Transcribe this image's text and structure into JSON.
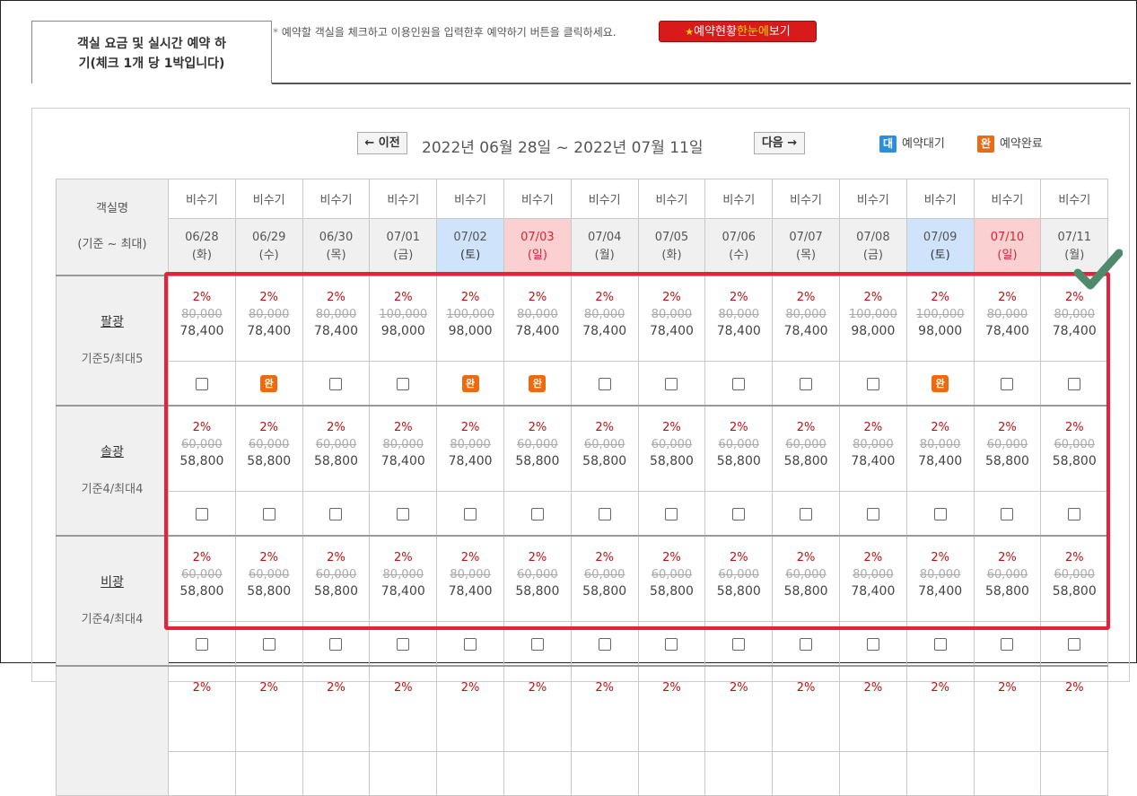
{
  "tab": {
    "title_line1": "객실 요금 및 실시간 예약 하",
    "title_line2": "기(체크 1개 당 1박입니다)"
  },
  "notice": {
    "icon": "*",
    "text": "예약할 객실을 체크하고 이용인원을 입력한후 예약하기 버튼을 클릭하세요."
  },
  "view_button": {
    "star": "★",
    "part1": "예약현황",
    "part2": "한눈에",
    "part3": "보기"
  },
  "nav": {
    "prev": "← 이전",
    "next": "다음 →",
    "range": "2022년 06월 28일 ~ 2022년 07월 11일"
  },
  "legend": {
    "waiting_badge": "대",
    "waiting_label": "예약대기",
    "waiting_color": "#2b8fd9",
    "done_badge": "완",
    "done_label": "예약완료",
    "done_color": "#ef6a0e"
  },
  "table": {
    "room_header_line1": "객실명",
    "room_header_line2": "(기준 ~ 최대)",
    "columns": [
      {
        "season": "비수기",
        "date": "06/28",
        "dow": "(화)",
        "type": "weekday"
      },
      {
        "season": "비수기",
        "date": "06/29",
        "dow": "(수)",
        "type": "weekday"
      },
      {
        "season": "비수기",
        "date": "06/30",
        "dow": "(목)",
        "type": "weekday"
      },
      {
        "season": "비수기",
        "date": "07/01",
        "dow": "(금)",
        "type": "weekday"
      },
      {
        "season": "비수기",
        "date": "07/02",
        "dow": "(토)",
        "type": "sat"
      },
      {
        "season": "비수기",
        "date": "07/03",
        "dow": "(일)",
        "type": "sun"
      },
      {
        "season": "비수기",
        "date": "07/04",
        "dow": "(월)",
        "type": "weekday"
      },
      {
        "season": "비수기",
        "date": "07/05",
        "dow": "(화)",
        "type": "weekday"
      },
      {
        "season": "비수기",
        "date": "07/06",
        "dow": "(수)",
        "type": "weekday"
      },
      {
        "season": "비수기",
        "date": "07/07",
        "dow": "(목)",
        "type": "weekday"
      },
      {
        "season": "비수기",
        "date": "07/08",
        "dow": "(금)",
        "type": "weekday"
      },
      {
        "season": "비수기",
        "date": "07/09",
        "dow": "(토)",
        "type": "sat"
      },
      {
        "season": "비수기",
        "date": "07/10",
        "dow": "(일)",
        "type": "sun"
      },
      {
        "season": "비수기",
        "date": "07/11",
        "dow": "(월)",
        "type": "weekday"
      }
    ],
    "rooms": [
      {
        "name": "팔광",
        "capacity": "기준5/최대5",
        "cells": [
          {
            "rate": "2%",
            "orig": "80,000",
            "price": "78,400",
            "status": "open"
          },
          {
            "rate": "2%",
            "orig": "80,000",
            "price": "78,400",
            "status": "done"
          },
          {
            "rate": "2%",
            "orig": "80,000",
            "price": "78,400",
            "status": "open"
          },
          {
            "rate": "2%",
            "orig": "100,000",
            "price": "98,000",
            "status": "open"
          },
          {
            "rate": "2%",
            "orig": "100,000",
            "price": "98,000",
            "status": "done"
          },
          {
            "rate": "2%",
            "orig": "80,000",
            "price": "78,400",
            "status": "done"
          },
          {
            "rate": "2%",
            "orig": "80,000",
            "price": "78,400",
            "status": "open"
          },
          {
            "rate": "2%",
            "orig": "80,000",
            "price": "78,400",
            "status": "open"
          },
          {
            "rate": "2%",
            "orig": "80,000",
            "price": "78,400",
            "status": "open"
          },
          {
            "rate": "2%",
            "orig": "80,000",
            "price": "78,400",
            "status": "open"
          },
          {
            "rate": "2%",
            "orig": "100,000",
            "price": "98,000",
            "status": "open"
          },
          {
            "rate": "2%",
            "orig": "100,000",
            "price": "98,000",
            "status": "done"
          },
          {
            "rate": "2%",
            "orig": "80,000",
            "price": "78,400",
            "status": "open"
          },
          {
            "rate": "2%",
            "orig": "80,000",
            "price": "78,400",
            "status": "open"
          }
        ]
      },
      {
        "name": "솔광",
        "capacity": "기준4/최대4",
        "cells": [
          {
            "rate": "2%",
            "orig": "60,000",
            "price": "58,800",
            "status": "open"
          },
          {
            "rate": "2%",
            "orig": "60,000",
            "price": "58,800",
            "status": "open"
          },
          {
            "rate": "2%",
            "orig": "60,000",
            "price": "58,800",
            "status": "open"
          },
          {
            "rate": "2%",
            "orig": "80,000",
            "price": "78,400",
            "status": "open"
          },
          {
            "rate": "2%",
            "orig": "80,000",
            "price": "78,400",
            "status": "open"
          },
          {
            "rate": "2%",
            "orig": "60,000",
            "price": "58,800",
            "status": "open"
          },
          {
            "rate": "2%",
            "orig": "60,000",
            "price": "58,800",
            "status": "open"
          },
          {
            "rate": "2%",
            "orig": "60,000",
            "price": "58,800",
            "status": "open"
          },
          {
            "rate": "2%",
            "orig": "60,000",
            "price": "58,800",
            "status": "open"
          },
          {
            "rate": "2%",
            "orig": "60,000",
            "price": "58,800",
            "status": "open"
          },
          {
            "rate": "2%",
            "orig": "80,000",
            "price": "78,400",
            "status": "open"
          },
          {
            "rate": "2%",
            "orig": "80,000",
            "price": "78,400",
            "status": "open"
          },
          {
            "rate": "2%",
            "orig": "60,000",
            "price": "58,800",
            "status": "open"
          },
          {
            "rate": "2%",
            "orig": "60,000",
            "price": "58,800",
            "status": "open"
          }
        ]
      },
      {
        "name": "비광",
        "capacity": "기준4/최대4",
        "cells": [
          {
            "rate": "2%",
            "orig": "60,000",
            "price": "58,800",
            "status": "open"
          },
          {
            "rate": "2%",
            "orig": "60,000",
            "price": "58,800",
            "status": "open"
          },
          {
            "rate": "2%",
            "orig": "60,000",
            "price": "58,800",
            "status": "open"
          },
          {
            "rate": "2%",
            "orig": "80,000",
            "price": "78,400",
            "status": "open"
          },
          {
            "rate": "2%",
            "orig": "80,000",
            "price": "78,400",
            "status": "open"
          },
          {
            "rate": "2%",
            "orig": "60,000",
            "price": "58,800",
            "status": "open"
          },
          {
            "rate": "2%",
            "orig": "60,000",
            "price": "58,800",
            "status": "open"
          },
          {
            "rate": "2%",
            "orig": "60,000",
            "price": "58,800",
            "status": "open"
          },
          {
            "rate": "2%",
            "orig": "60,000",
            "price": "58,800",
            "status": "open"
          },
          {
            "rate": "2%",
            "orig": "60,000",
            "price": "58,800",
            "status": "open"
          },
          {
            "rate": "2%",
            "orig": "80,000",
            "price": "78,400",
            "status": "open"
          },
          {
            "rate": "2%",
            "orig": "80,000",
            "price": "78,400",
            "status": "open"
          },
          {
            "rate": "2%",
            "orig": "60,000",
            "price": "58,800",
            "status": "open"
          },
          {
            "rate": "2%",
            "orig": "60,000",
            "price": "58,800",
            "status": "open"
          }
        ]
      },
      {
        "name": "",
        "capacity": "",
        "cells": [
          {
            "rate": "2%",
            "orig": "",
            "price": "",
            "status": ""
          },
          {
            "rate": "2%",
            "orig": "",
            "price": "",
            "status": ""
          },
          {
            "rate": "2%",
            "orig": "",
            "price": "",
            "status": ""
          },
          {
            "rate": "2%",
            "orig": "",
            "price": "",
            "status": ""
          },
          {
            "rate": "2%",
            "orig": "",
            "price": "",
            "status": ""
          },
          {
            "rate": "2%",
            "orig": "",
            "price": "",
            "status": ""
          },
          {
            "rate": "2%",
            "orig": "",
            "price": "",
            "status": ""
          },
          {
            "rate": "2%",
            "orig": "",
            "price": "",
            "status": ""
          },
          {
            "rate": "2%",
            "orig": "",
            "price": "",
            "status": ""
          },
          {
            "rate": "2%",
            "orig": "",
            "price": "",
            "status": ""
          },
          {
            "rate": "2%",
            "orig": "",
            "price": "",
            "status": ""
          },
          {
            "rate": "2%",
            "orig": "",
            "price": "",
            "status": ""
          },
          {
            "rate": "2%",
            "orig": "",
            "price": "",
            "status": ""
          },
          {
            "rate": "2%",
            "orig": "",
            "price": "",
            "status": ""
          }
        ]
      }
    ]
  },
  "annotation": {
    "highlight_color": "#e8203a",
    "check_color": "#4e8a6b",
    "check_icon": "checkmark-icon"
  }
}
